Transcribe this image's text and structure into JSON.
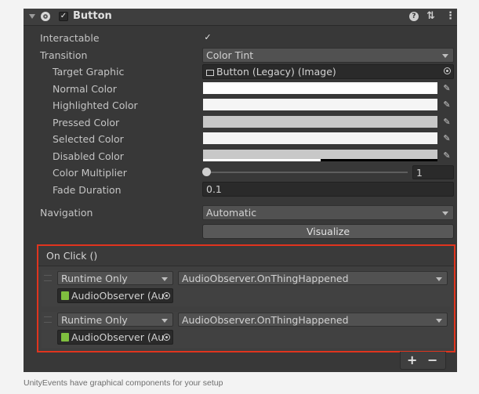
{
  "component": {
    "title": "Button",
    "enabled": true,
    "icons": [
      "foldout-arrow-icon",
      "component-icon",
      "help-icon",
      "presets-icon",
      "more-icon"
    ]
  },
  "properties": {
    "interactable_label": "Interactable",
    "interactable_value": true,
    "transition_label": "Transition",
    "transition_value": "Color Tint",
    "target_graphic_label": "Target Graphic",
    "target_graphic_value": "Button (Legacy) (Image)",
    "normal_color_label": "Normal Color",
    "normal_color": "#ffffff",
    "highlighted_color_label": "Highlighted Color",
    "highlighted_color": "#f5f5f5",
    "pressed_color_label": "Pressed Color",
    "pressed_color": "#c8c8c8",
    "selected_color_label": "Selected Color",
    "selected_color": "#f5f5f5",
    "disabled_color_label": "Disabled Color",
    "disabled_color": "#c8c8c8",
    "color_multiplier_label": "Color Multiplier",
    "color_multiplier_value": "1",
    "fade_duration_label": "Fade Duration",
    "fade_duration_value": "0.1",
    "navigation_label": "Navigation",
    "navigation_value": "Automatic",
    "visualize_label": "Visualize"
  },
  "on_click": {
    "title": "On Click ()",
    "entries": [
      {
        "runtime": "Runtime Only",
        "function": "AudioObserver.OnThingHappened",
        "object": "AudioObserver (Au"
      },
      {
        "runtime": "Runtime Only",
        "function": "AudioObserver.OnThingHappened",
        "object": "AudioObserver (Au"
      }
    ],
    "add_label": "+",
    "remove_label": "−"
  },
  "caption": "UnityEvents have graphical components for your setup",
  "colors": {
    "highlight_border": "#e0341e",
    "panel": "#383838"
  }
}
